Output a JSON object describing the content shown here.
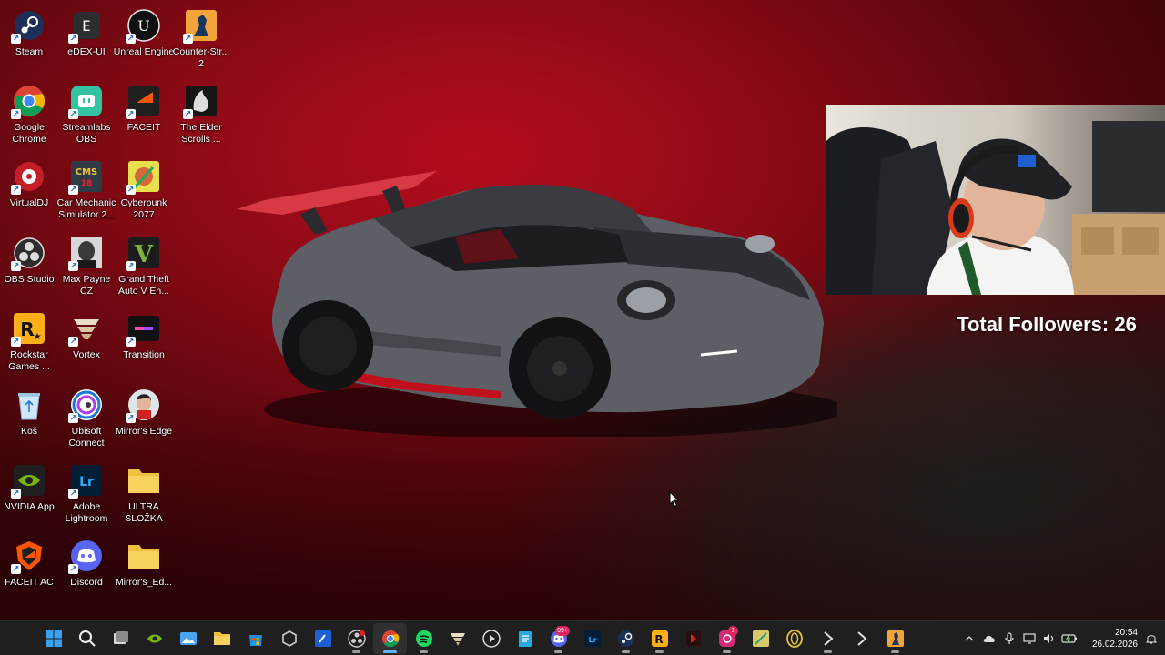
{
  "desktop": {
    "icons": [
      {
        "label": "Steam",
        "icon": "steam-icon"
      },
      {
        "label": "eDEX-UI",
        "icon": "edex-ui-icon"
      },
      {
        "label": "Unreal Engine",
        "icon": "unreal-engine-icon"
      },
      {
        "label": "Counter-Str... 2",
        "icon": "counter-strike-icon"
      },
      {
        "label": "Google Chrome",
        "icon": "chrome-icon"
      },
      {
        "label": "Streamlabs OBS",
        "icon": "streamlabs-icon"
      },
      {
        "label": "FACEIT",
        "icon": "faceit-icon"
      },
      {
        "label": "The Elder Scrolls ...",
        "icon": "elder-scrolls-icon"
      },
      {
        "label": "VirtualDJ",
        "icon": "virtualdj-icon"
      },
      {
        "label": "Car Mechanic Simulator 2...",
        "icon": "car-mechanic-icon"
      },
      {
        "label": "Cyberpunk 2077",
        "icon": "cyberpunk-icon"
      },
      {
        "label": "OBS Studio",
        "icon": "obs-icon"
      },
      {
        "label": "Max Payne CZ",
        "icon": "max-payne-icon"
      },
      {
        "label": "Grand Theft Auto V En...",
        "icon": "gta-v-icon"
      },
      {
        "label": "Rockstar Games ...",
        "icon": "rockstar-icon"
      },
      {
        "label": "Vortex",
        "icon": "vortex-icon"
      },
      {
        "label": "Transition",
        "icon": "transition-icon"
      },
      {
        "label": "Koš",
        "icon": "recycle-bin-icon"
      },
      {
        "label": "Ubisoft Connect",
        "icon": "ubisoft-icon"
      },
      {
        "label": "Mirror's Edge",
        "icon": "mirrors-edge-icon"
      },
      {
        "label": "NVIDIA App",
        "icon": "nvidia-icon"
      },
      {
        "label": "Adobe Lightroom",
        "icon": "lightroom-icon"
      },
      {
        "label": "ULTRA SLOŽKA",
        "icon": "folder-icon"
      },
      {
        "label": "FACEIT AC",
        "icon": "faceit-ac-icon"
      },
      {
        "label": "Discord",
        "icon": "discord-icon"
      },
      {
        "label": "Mirror's_Ed...",
        "icon": "folder-icon"
      }
    ]
  },
  "overlay": {
    "followers_text": "Total Followers: 26"
  },
  "taskbar": {
    "apps": [
      {
        "name": "start-button",
        "icon": "windows-icon"
      },
      {
        "name": "search-button",
        "icon": "search-icon"
      },
      {
        "name": "task-view-button",
        "icon": "task-view-icon"
      },
      {
        "name": "taskbar-nvidia",
        "icon": "nvidia-icon"
      },
      {
        "name": "taskbar-photos",
        "icon": "photos-icon"
      },
      {
        "name": "taskbar-file-explorer",
        "icon": "folder-icon"
      },
      {
        "name": "taskbar-store",
        "icon": "store-icon"
      },
      {
        "name": "taskbar-unity",
        "icon": "unity-icon"
      },
      {
        "name": "taskbar-vscode-alt",
        "icon": "code-icon"
      },
      {
        "name": "taskbar-obs",
        "icon": "obs-icon"
      },
      {
        "name": "taskbar-chrome",
        "icon": "chrome-icon"
      },
      {
        "name": "taskbar-spotify",
        "icon": "spotify-icon"
      },
      {
        "name": "taskbar-vortex",
        "icon": "vortex-icon"
      },
      {
        "name": "taskbar-media-player",
        "icon": "play-icon"
      },
      {
        "name": "taskbar-notepad",
        "icon": "notepad-icon"
      },
      {
        "name": "taskbar-discord",
        "icon": "discord-icon",
        "badge": "99+"
      },
      {
        "name": "taskbar-lightroom",
        "icon": "lightroom-icon"
      },
      {
        "name": "taskbar-steam",
        "icon": "steam-icon"
      },
      {
        "name": "taskbar-rockstar",
        "icon": "rockstar-icon"
      },
      {
        "name": "taskbar-app-red",
        "icon": "app-icon"
      },
      {
        "name": "taskbar-instagram",
        "icon": "instagram-icon",
        "badge": "1"
      },
      {
        "name": "taskbar-game",
        "icon": "game-icon"
      },
      {
        "name": "taskbar-ring-app",
        "icon": "ring-icon"
      },
      {
        "name": "taskbar-arrow-app",
        "icon": "arrow-icon"
      },
      {
        "name": "taskbar-arrow-app-2",
        "icon": "arrow-icon"
      },
      {
        "name": "taskbar-counter-strike",
        "icon": "counter-strike-icon"
      }
    ],
    "clock": {
      "time": "20:54",
      "date": "26.02.2026"
    }
  }
}
